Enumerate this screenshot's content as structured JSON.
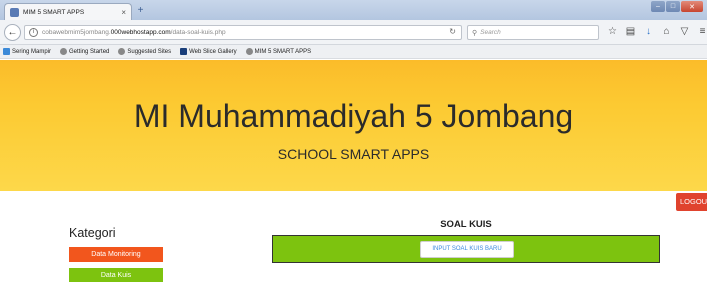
{
  "browser": {
    "tab_title": "MIM 5 SMART APPS",
    "tab_close": "×",
    "new_tab": "+",
    "url_prefix": "cobawebmim5jombang.",
    "url_domain": "000webhostapp.com",
    "url_path": "/data-soal-kuis.php",
    "search_placeholder": "Search",
    "bookmarks": [
      {
        "label": "Sering Mampir"
      },
      {
        "label": "Getting Started"
      },
      {
        "label": "Suggested Sites"
      },
      {
        "label": "Web Slice Gallery"
      },
      {
        "label": "MIM 5 SMART APPS"
      }
    ]
  },
  "header": {
    "title": "MI Muhammadiyah 5 Jombang",
    "subtitle": "SCHOOL SMART APPS"
  },
  "logout_label": "LOGOUT",
  "sidebar": {
    "heading": "Kategori",
    "items": [
      {
        "label": "Data Monitoring",
        "color": "#f2561d"
      },
      {
        "label": "Data Kuis",
        "color": "#7dc30f"
      }
    ]
  },
  "main": {
    "title": "SOAL KUIS",
    "input_button_label": "INPUT SOAL KUIS BARU"
  },
  "colors": {
    "header_yellow": "#fdc832",
    "logout_red": "#e0432e",
    "panel_green": "#7dc30f"
  }
}
